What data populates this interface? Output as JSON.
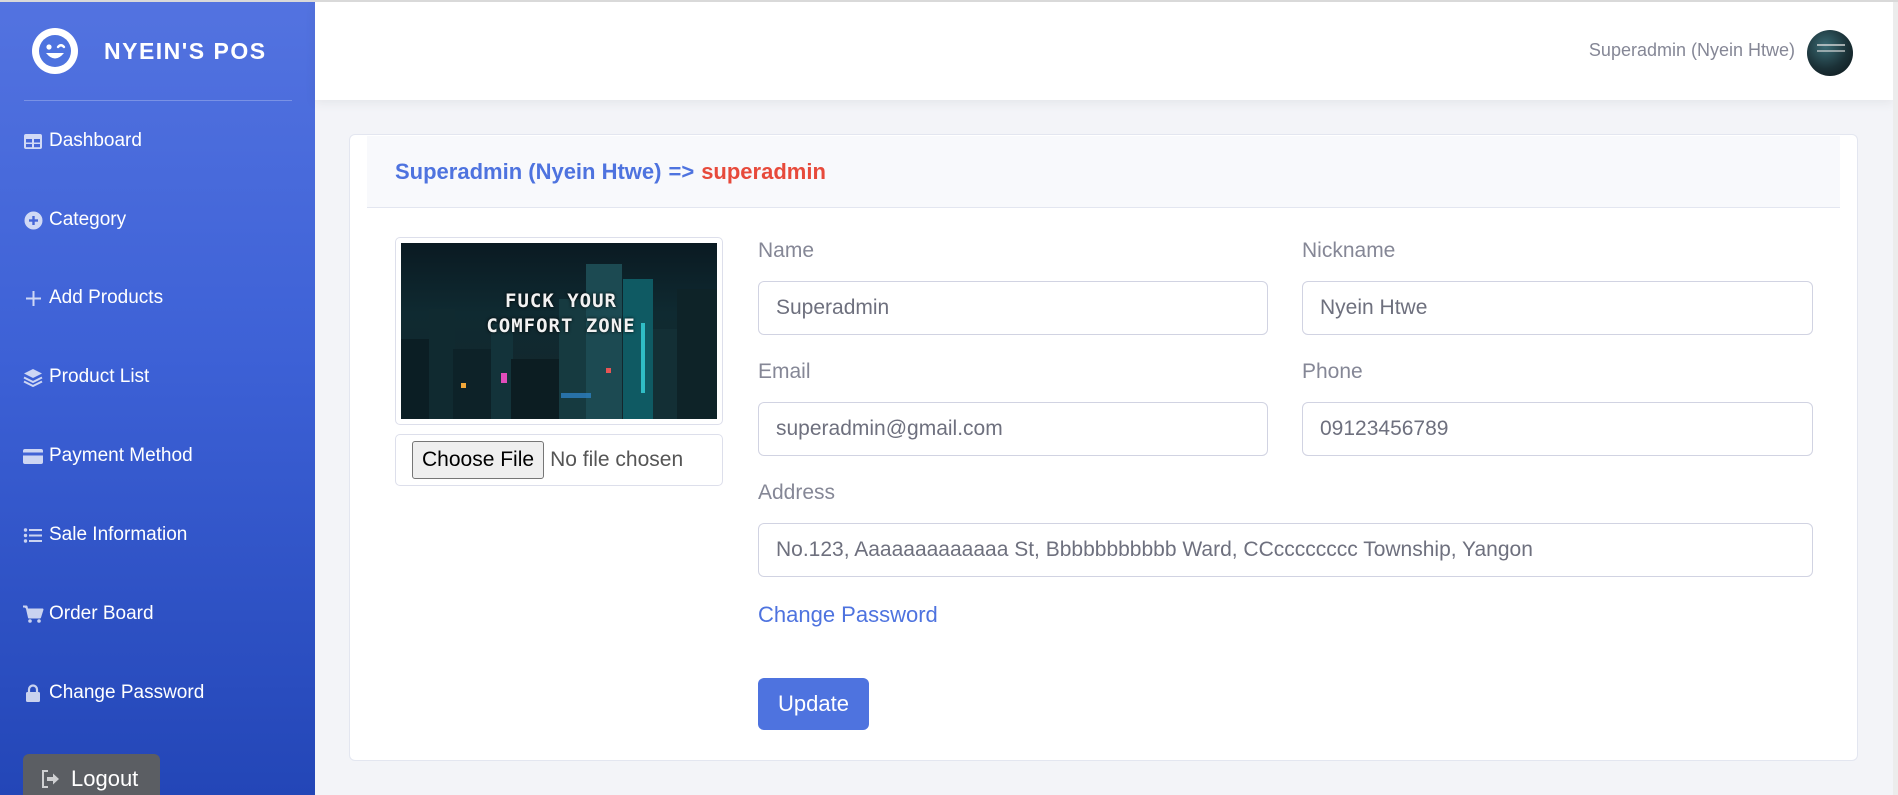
{
  "brand": {
    "name": "NYEIN'S POS",
    "logo_icon": "laugh-wink-icon"
  },
  "sidebar": {
    "items": [
      {
        "label": "Dashboard",
        "icon": "table-icon"
      },
      {
        "label": "Category",
        "icon": "plus-circle-icon"
      },
      {
        "label": "Add Products",
        "icon": "plus-icon"
      },
      {
        "label": "Product List",
        "icon": "layers-icon"
      },
      {
        "label": "Payment Method",
        "icon": "credit-card-icon"
      },
      {
        "label": "Sale Information",
        "icon": "list-icon"
      },
      {
        "label": "Order Board",
        "icon": "cart-icon"
      },
      {
        "label": "Change Password",
        "icon": "lock-icon"
      }
    ],
    "logout_label": "Logout"
  },
  "topbar": {
    "user_name": "Superadmin (Nyein Htwe)"
  },
  "card": {
    "header_user": "Superadmin (Nyein Htwe)",
    "header_arrow": "=>",
    "header_role": "superadmin",
    "photo_caption_line1": "FUCK YOUR",
    "photo_caption_line2": "COMFORT ZONE",
    "file_button": "Choose File",
    "file_status": "No file chosen"
  },
  "form": {
    "name_label": "Name",
    "name_value": "Superadmin",
    "nickname_label": "Nickname",
    "nickname_value": "Nyein Htwe",
    "email_label": "Email",
    "email_value": "superadmin@gmail.com",
    "phone_label": "Phone",
    "phone_value": "09123456789",
    "address_label": "Address",
    "address_value": "No.123, Aaaaaaaaaaaaa St, Bbbbbbbbbbb Ward, CCcccccccc Township, Yangon",
    "change_password_link": "Change Password",
    "update_button": "Update"
  },
  "colors": {
    "primary": "#4e73df",
    "danger": "#e74a3b",
    "sidebar_top": "#5373e0",
    "sidebar_bottom": "#2346b7"
  }
}
